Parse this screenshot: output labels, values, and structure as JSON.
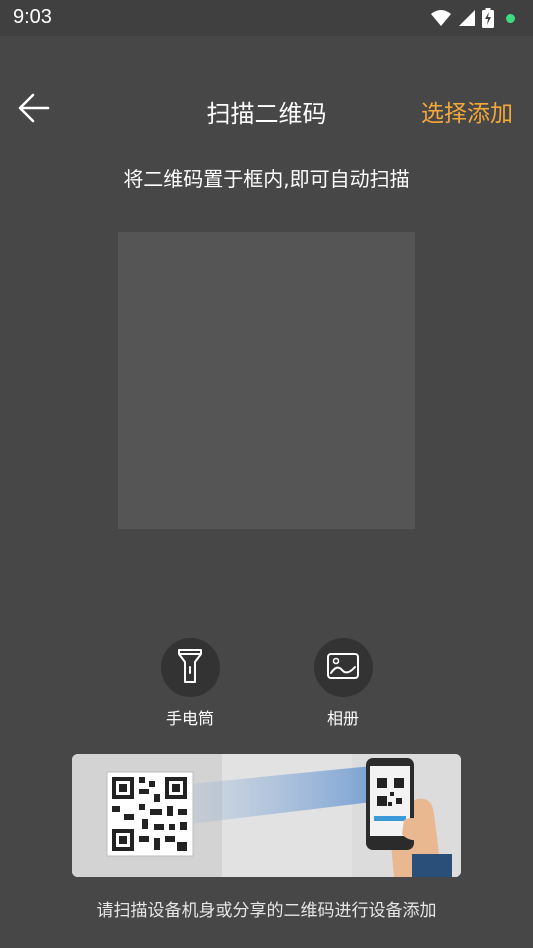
{
  "status_bar": {
    "time": "9:03",
    "icons": [
      "wifi-icon",
      "signal-icon",
      "battery-charging-icon",
      "notification-dot-icon"
    ],
    "dot_color": "#3ddc84"
  },
  "header": {
    "back_icon": "arrow-left-icon",
    "title": "扫描二维码",
    "action_label": "选择添加",
    "action_color": "#f4a83a"
  },
  "scanner": {
    "hint": "将二维码置于框内,即可自动扫描"
  },
  "tools": [
    {
      "icon": "flashlight-icon",
      "label": "手电筒"
    },
    {
      "icon": "image-icon",
      "label": "相册"
    }
  ],
  "guide": {
    "image": "phone-scanning-qr-code-illustration",
    "caption": "请扫描设备机身或分享的二维码进行设备添加"
  }
}
